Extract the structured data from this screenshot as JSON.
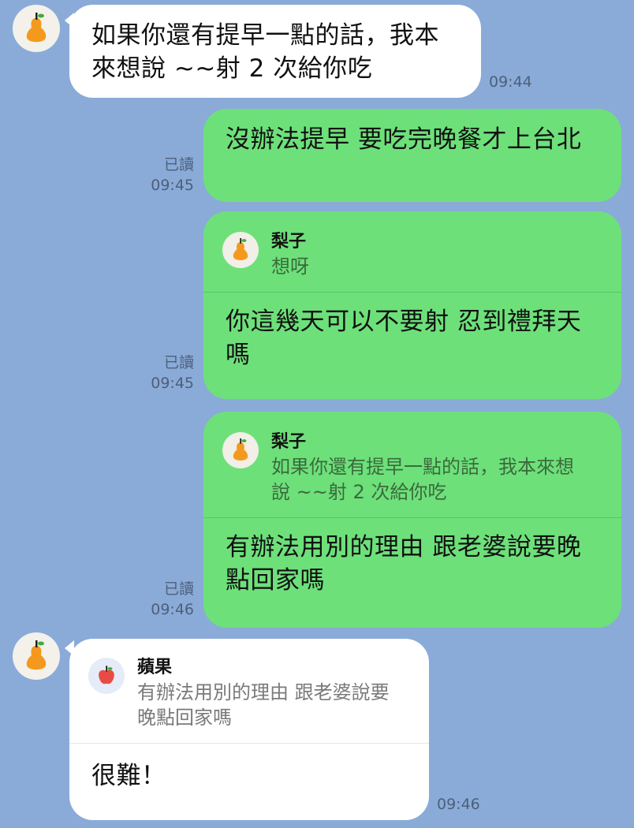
{
  "messages": [
    {
      "type": "incoming",
      "text": "如果你還有提早一點的話，我本來想說 ~~射 2 次給你吃",
      "time": "09:44",
      "avatar_icon": "pear-icon"
    },
    {
      "type": "outgoing",
      "read": "已讀",
      "time": "09:45",
      "text": "沒辦法提早 要吃完晚餐才上台北"
    },
    {
      "type": "outgoing_reply",
      "read": "已讀",
      "time": "09:45",
      "quote": {
        "name": "梨子",
        "text": "想呀",
        "icon": "pear-icon"
      },
      "text": "你這幾天可以不要射 忍到禮拜天嗎"
    },
    {
      "type": "outgoing_reply",
      "read": "已讀",
      "time": "09:46",
      "quote": {
        "name": "梨子",
        "text": "如果你還有提早一點的話，我本來想說 ~~射 2 次給你吃",
        "icon": "pear-icon"
      },
      "text": "有辦法用別的理由 跟老婆說要晚點回家嗎"
    },
    {
      "type": "incoming_reply",
      "time": "09:46",
      "avatar_icon": "pear-icon",
      "quote": {
        "name": "蘋果",
        "text": "有辦法用別的理由 跟老婆說要晚點回家嗎",
        "icon": "apple-icon"
      },
      "text": "很難！"
    }
  ],
  "colors": {
    "background": "#8aabd8",
    "outgoing_bubble": "#6de07a",
    "incoming_bubble": "#ffffff",
    "pear_orange": "#f39a1e",
    "apple_red": "#e84b43"
  }
}
